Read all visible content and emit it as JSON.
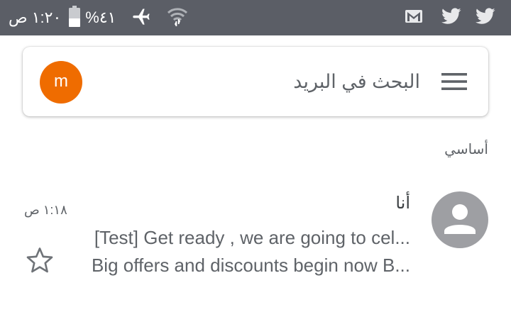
{
  "status_bar": {
    "time": "١:٢٠ ص",
    "battery_percent": "%٤١",
    "left_icons": [
      "battery-icon",
      "airplane-icon",
      "wifi-icon"
    ],
    "right_icons": [
      "gmail-icon",
      "twitter-icon",
      "twitter-icon"
    ],
    "background": "#5b5e66"
  },
  "search": {
    "placeholder": "البحث في البريد",
    "avatar_letter": "m",
    "avatar_color": "#ef6c00"
  },
  "section": {
    "label": "أساسي"
  },
  "emails": [
    {
      "sender": "أنا",
      "time": "١:١٨ ص",
      "subject": "[Test] Get ready , we are going to cel...",
      "snippet": "Big offers and discounts begin now B...",
      "starred": false
    }
  ]
}
